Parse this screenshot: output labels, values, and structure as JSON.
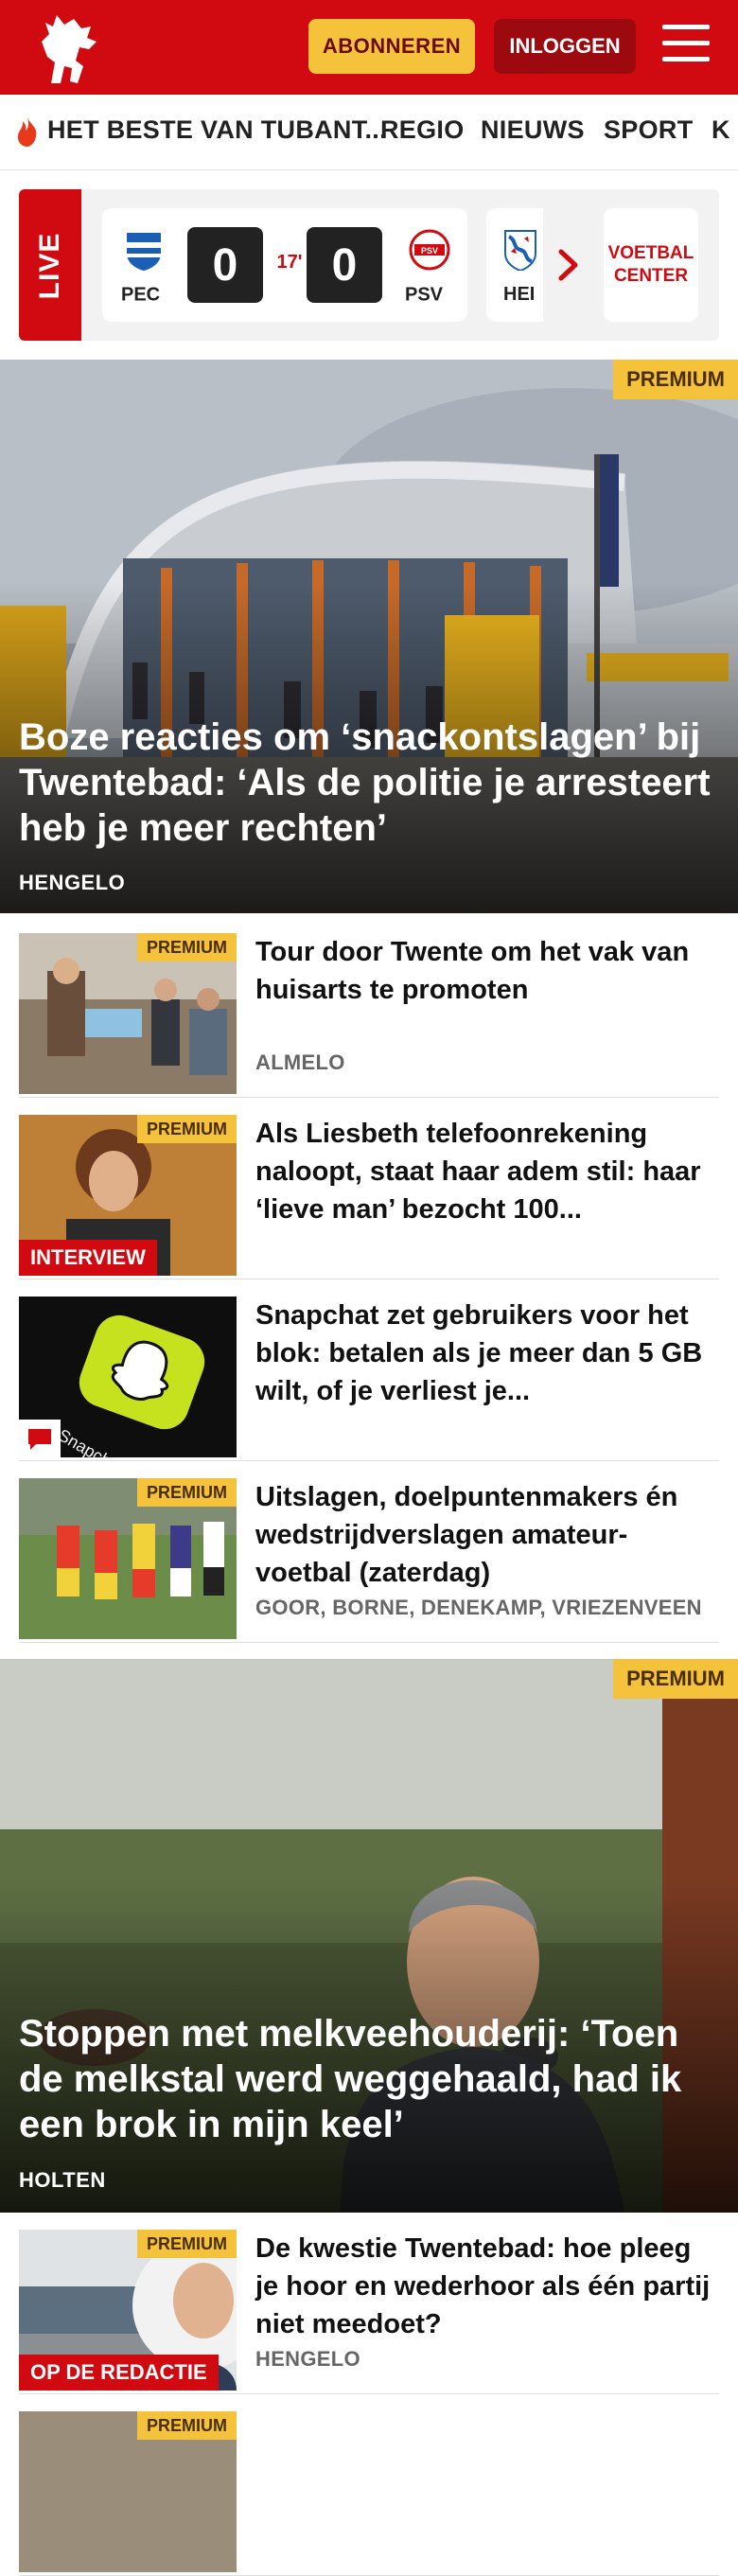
{
  "header": {
    "subscribe_label": "ABONNEREN",
    "login_label": "INLOGGEN",
    "colors": {
      "brand": "#d10a11",
      "accent": "#f5c33b"
    }
  },
  "nav": {
    "items": [
      "HET BESTE VAN TUBANT...",
      "REGIO",
      "NIEUWS",
      "SPORT",
      "K"
    ]
  },
  "live": {
    "label": "LIVE",
    "match": {
      "home": "PEC",
      "away": "PSV",
      "home_score": "0",
      "away_score": "0",
      "minute": "17'"
    },
    "next_team": "HEI",
    "center_label_1": "VOETBAL",
    "center_label_2": "CENTER"
  },
  "articles": [
    {
      "premium": "PREMIUM",
      "title": "Boze reacties om ‘snackontslagen’ bij Twentebad: ‘Als de politie je arresteert heb je meer rechten’",
      "location": "HENGELO"
    },
    {
      "premium": "PREMIUM",
      "title": "Tour door Twente om het vak van huisarts te promoten",
      "location": "ALMELO"
    },
    {
      "premium": "PREMIUM",
      "tag": "INTERVIEW",
      "title": "Als Liesbeth telefoonrekening naloopt, staat haar adem stil: haar ‘lieve man’ bezocht 100...",
      "location": ""
    },
    {
      "title": "Snapchat zet gebruikers voor het blok: betalen als je meer dan 5 GB wilt, of je verliest je...",
      "location": "",
      "icon": "comment-icon",
      "thumb_text": "Snapchat"
    },
    {
      "premium": "PREMIUM",
      "title": "Uitslagen, doelpuntenmakers én wedstrijdverslagen amateur-voetbal (zaterdag)",
      "location": "GOOR, BORNE, DENEKAMP, VRIEZENVEEN"
    },
    {
      "premium": "PREMIUM",
      "title": "Stoppen met melkveehouderij: ‘Toen de melkstal werd weggehaald, had ik een brok in mijn keel’",
      "location": "HOLTEN"
    },
    {
      "premium": "PREMIUM",
      "tag": "OP DE REDACTIE",
      "title": "De kwestie Twentebad: hoe pleeg je hoor en wederhoor als één partij niet meedoet?",
      "location": "HENGELO"
    },
    {
      "premium": "PREMIUM"
    }
  ]
}
